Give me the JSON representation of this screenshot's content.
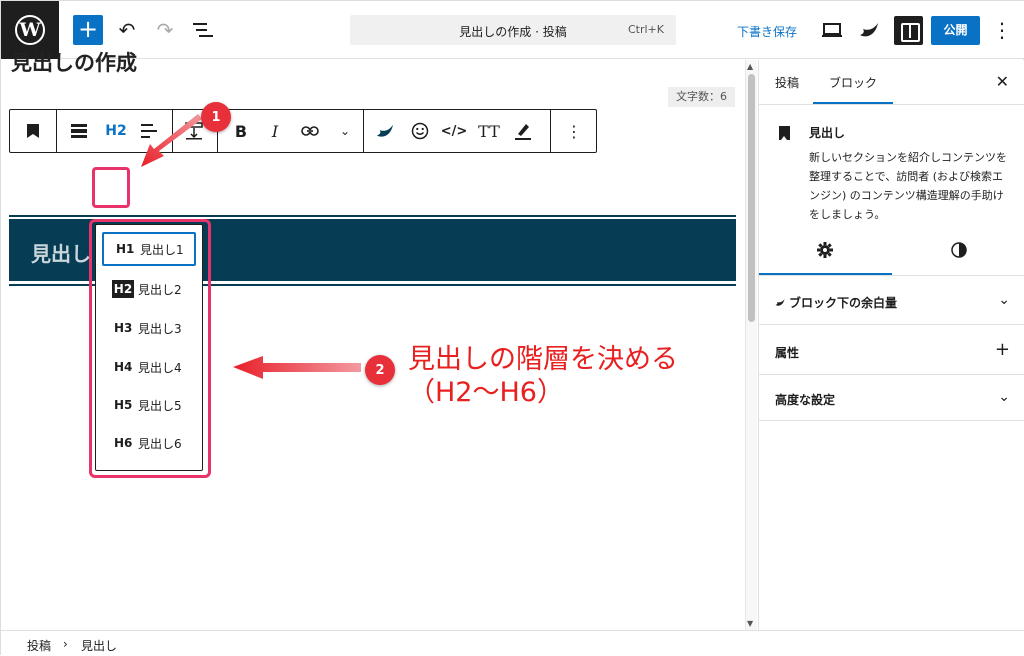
{
  "topbar": {
    "command_title": "見出しの作成 · 投稿",
    "command_shortcut": "Ctrl+K",
    "save_draft": "下書き保存",
    "publish": "公開"
  },
  "editor": {
    "post_title": "見出しの作成",
    "word_count": "文字数：6",
    "heading_text": "見出し",
    "toolbar": {
      "heading_level": "H2",
      "italic": "I",
      "bold": "B",
      "text_icon": "TT"
    },
    "level_menu": [
      {
        "level": "H1",
        "label": "見出し1"
      },
      {
        "level": "H2",
        "label": "見出し2"
      },
      {
        "level": "H3",
        "label": "見出し3"
      },
      {
        "level": "H4",
        "label": "見出し4"
      },
      {
        "level": "H5",
        "label": "見出し5"
      },
      {
        "level": "H6",
        "label": "見出し6"
      }
    ]
  },
  "annotations": {
    "badge1": "1",
    "badge2": "2",
    "note_line1": "見出しの階層を決める",
    "note_line2": "（H2〜H6）"
  },
  "sidebar": {
    "tab_post": "投稿",
    "tab_block": "ブロック",
    "close": "✕",
    "block_name": "見出し",
    "block_description": "新しいセクションを紹介しコンテンツを整理することで、訪問者 (および検索エンジン) のコンテンツ構造理解の手助けをしましょう。",
    "panel_spacing": "ブロック下の余白量",
    "panel_attributes": "属性",
    "panel_advanced": "高度な設定"
  },
  "footer": {
    "crumb_root": "投稿",
    "crumb_sep": "›",
    "crumb_current": "見出し"
  },
  "colors": {
    "accent": "#0a72c4",
    "heading_bg": "#063c54",
    "highlight": "#e8336b",
    "annotation_red": "#e8303a"
  }
}
